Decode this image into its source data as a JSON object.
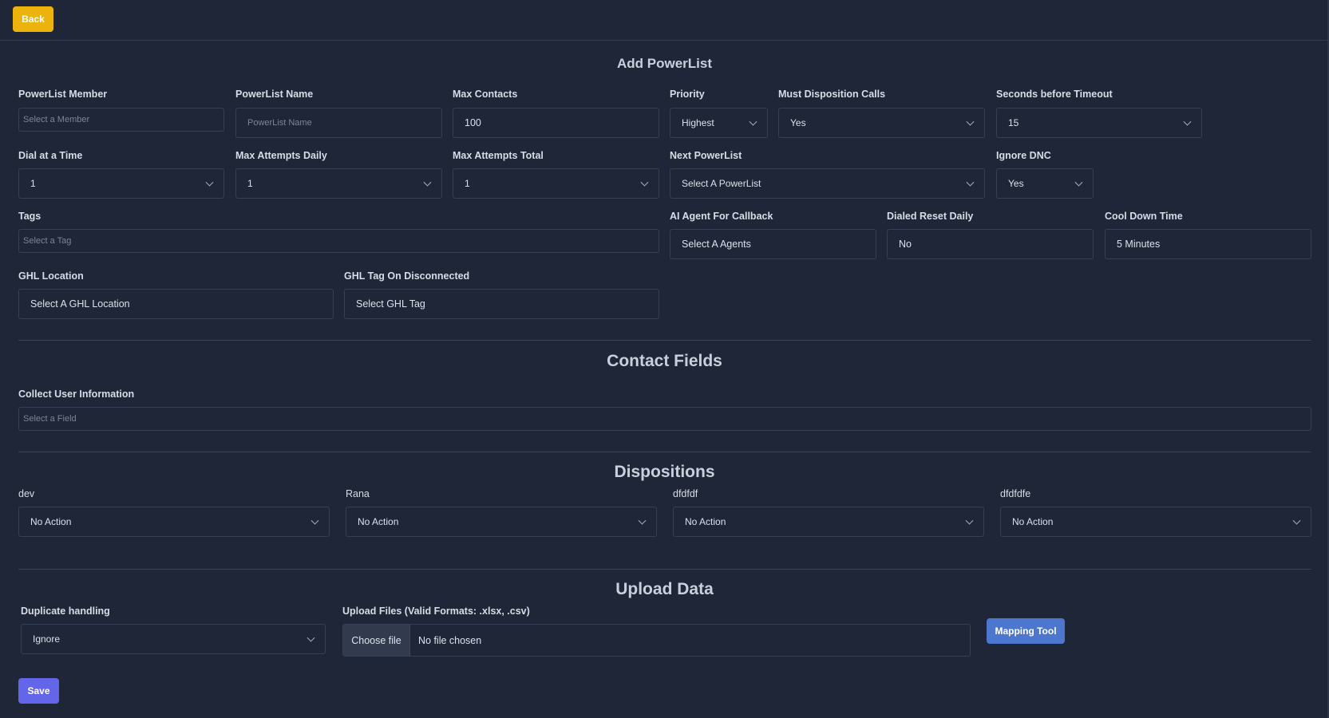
{
  "header": {
    "back_label": "Back"
  },
  "form": {
    "title": "Add PowerList",
    "fields": {
      "member": {
        "label": "PowerList Member",
        "placeholder": "Select a Member"
      },
      "name": {
        "label": "PowerList Name",
        "placeholder": "PowerList Name"
      },
      "max_contacts": {
        "label": "Max Contacts",
        "value": "100"
      },
      "priority": {
        "label": "Priority",
        "value": "Highest"
      },
      "must_disposition": {
        "label": "Must Disposition Calls",
        "value": "Yes"
      },
      "seconds_timeout": {
        "label": "Seconds before Timeout",
        "value": "15"
      },
      "dial_at_time": {
        "label": "Dial at a Time",
        "value": "1"
      },
      "max_attempts_daily": {
        "label": "Max Attempts Daily",
        "value": "1"
      },
      "max_attempts_total": {
        "label": "Max Attempts Total",
        "value": "1"
      },
      "next_powerlist": {
        "label": "Next PowerList",
        "value": "Select A PowerList"
      },
      "ignore_dnc": {
        "label": "Ignore DNC",
        "value": "Yes"
      },
      "tags": {
        "label": "Tags",
        "placeholder": "Select a Tag"
      },
      "ai_agent": {
        "label": "AI Agent For Callback",
        "value": "Select A Agents"
      },
      "dialed_reset": {
        "label": "Dialed Reset Daily",
        "value": "No"
      },
      "cool_down": {
        "label": "Cool Down Time",
        "value": "5 Minutes"
      },
      "ghl_location": {
        "label": "GHL Location",
        "value": "Select A GHL Location"
      },
      "ghl_tag": {
        "label": "GHL Tag On Disconnected",
        "value": "Select GHL Tag"
      }
    }
  },
  "contact_fields": {
    "title": "Contact Fields",
    "collect_label": "Collect User Information",
    "collect_placeholder": "Select a Field"
  },
  "dispositions": {
    "title": "Dispositions",
    "items": [
      {
        "label": "dev",
        "value": "No Action"
      },
      {
        "label": "Rana",
        "value": "No Action"
      },
      {
        "label": "dfdfdf",
        "value": "No Action"
      },
      {
        "label": "dfdfdfe",
        "value": "No Action"
      }
    ]
  },
  "upload": {
    "title": "Upload Data",
    "duplicate_label": "Duplicate handling",
    "duplicate_value": "Ignore",
    "files_label": "Upload Files (Valid Formats: .xlsx, .csv)",
    "choose_file": "Choose file",
    "no_file": "No file chosen",
    "mapping_label": "Mapping Tool"
  },
  "footer": {
    "save_label": "Save"
  }
}
